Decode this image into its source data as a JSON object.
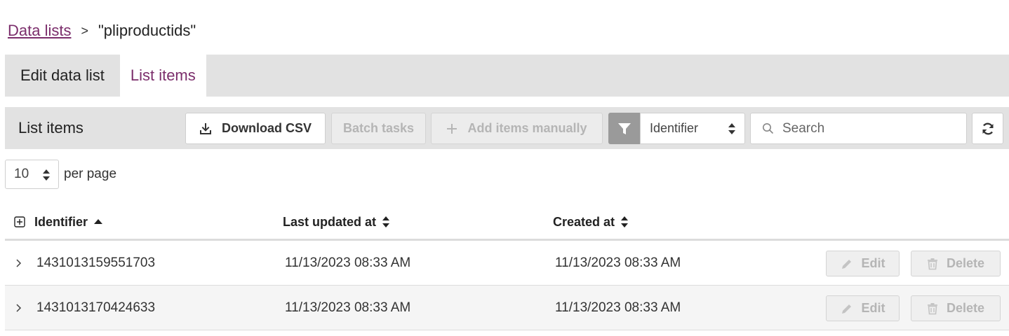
{
  "breadcrumb": {
    "parent": "Data lists",
    "separator": ">",
    "current": "\"pliproductids\""
  },
  "tabs": [
    {
      "label": "Edit data list",
      "active": false
    },
    {
      "label": "List items",
      "active": true
    }
  ],
  "toolbar": {
    "title": "List items",
    "download_label": "Download CSV",
    "batch_label": "Batch tasks",
    "add_label": "Add items manually",
    "filter_field": "Identifier",
    "search_placeholder": "Search"
  },
  "pagination": {
    "per_page_value": "10",
    "per_page_label": "per page"
  },
  "table": {
    "headers": {
      "identifier": "Identifier",
      "last_updated": "Last updated at",
      "created": "Created at"
    },
    "sort": {
      "column": "identifier",
      "direction": "ascending"
    },
    "rows": [
      {
        "identifier": "1431013159551703",
        "last_updated": "11/13/2023 08:33 AM",
        "created": "11/13/2023 08:33 AM",
        "edit_label": "Edit",
        "delete_label": "Delete"
      },
      {
        "identifier": "1431013170424633",
        "last_updated": "11/13/2023 08:33 AM",
        "created": "11/13/2023 08:33 AM",
        "edit_label": "Edit",
        "delete_label": "Delete"
      }
    ]
  },
  "colors": {
    "accent": "#7b2d6b",
    "bar_background": "#e2e2e2",
    "disabled_text": "#b5b5b5",
    "filter_icon_bg": "#9a9a9a"
  },
  "icons": {
    "download": "download-icon",
    "add": "plus-icon",
    "filter": "filter-icon",
    "sort_updown": "sort-updown-icon",
    "search": "search-icon",
    "refresh": "refresh-icon",
    "expand_all": "expand-all-icon",
    "row_expand": "chevron-right-icon",
    "edit": "pencil-icon",
    "delete": "trash-icon"
  }
}
